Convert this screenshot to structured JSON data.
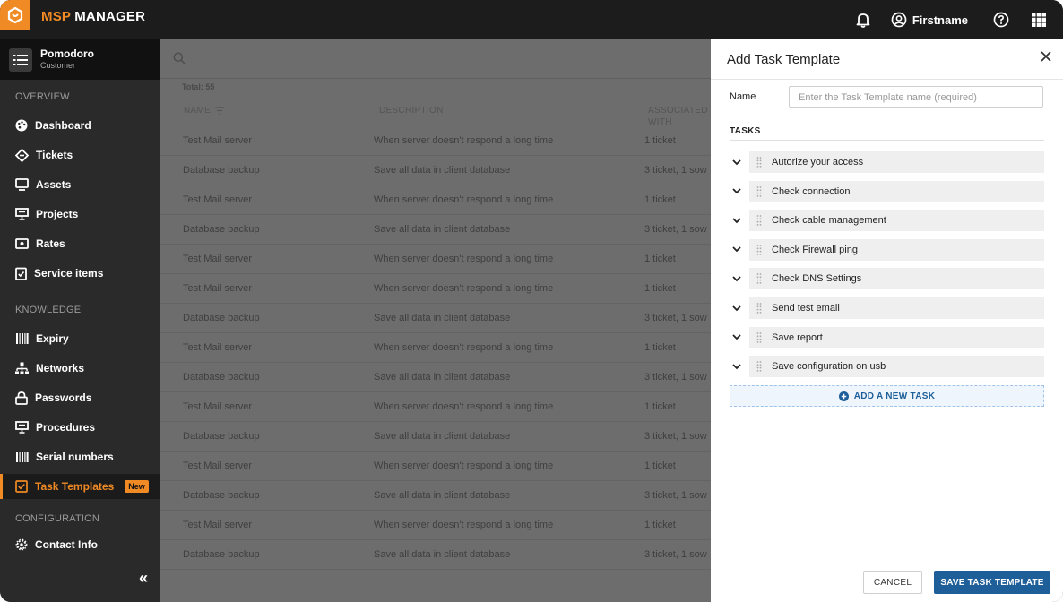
{
  "header": {
    "brand_prefix": "MSP",
    "brand_suffix": " MANAGER",
    "user_name": "Firstname",
    "icons": [
      "logo-icon",
      "bell-icon",
      "user-circle-icon",
      "help-icon",
      "apps-grid-icon"
    ],
    "accent_color": "#f08a24"
  },
  "customer": {
    "name": "Pomodoro",
    "subtitle": "Customer"
  },
  "sidebar": {
    "overview_label": "OVERVIEW",
    "knowledge_label": "KNOWLEDGE",
    "configuration_label": "CONFIGURATION",
    "overview_items": [
      {
        "label": "Dashboard",
        "icon": "palette-icon"
      },
      {
        "label": "Tickets",
        "icon": "ticket-icon"
      },
      {
        "label": "Assets",
        "icon": "monitor-icon"
      },
      {
        "label": "Projects",
        "icon": "presentation-icon"
      },
      {
        "label": "Rates",
        "icon": "money-icon"
      },
      {
        "label": "Service items",
        "icon": "clipboard-check-icon"
      }
    ],
    "knowledge_items": [
      {
        "label": "Expiry",
        "icon": "barcode-icon"
      },
      {
        "label": "Networks",
        "icon": "network-icon"
      },
      {
        "label": "Passwords",
        "icon": "lock-icon"
      },
      {
        "label": "Procedures",
        "icon": "presentation-icon"
      },
      {
        "label": "Serial numbers",
        "icon": "barcode-icon"
      },
      {
        "label": "Task Templates",
        "icon": "checkbox-icon",
        "badge": "New",
        "active": true
      }
    ],
    "configuration_items": [
      {
        "label": "Contact Info",
        "icon": "gear-icon"
      }
    ],
    "collapse_label": "«"
  },
  "list": {
    "total_label": "Total: 55",
    "columns": [
      "NAME",
      "DESCRIPTION",
      "ASSOCIATED WITH"
    ],
    "rows": [
      {
        "name": "Test Mail server",
        "description": "When server doesn't respond a long time",
        "associated": "1 ticket"
      },
      {
        "name": "Database backup",
        "description": "Save all data in client database",
        "associated": "3 ticket, 1 sow"
      },
      {
        "name": "Test Mail server",
        "description": "When server doesn't respond a long time",
        "associated": "1 ticket"
      },
      {
        "name": "Database backup",
        "description": "Save all data in client database",
        "associated": "3 ticket, 1 sow"
      },
      {
        "name": "Test Mail server",
        "description": "When server doesn't respond a long time",
        "associated": "1 ticket"
      },
      {
        "name": "Test Mail server",
        "description": "When server doesn't respond a long time",
        "associated": "1 ticket"
      },
      {
        "name": "Database backup",
        "description": "Save all data in client database",
        "associated": "3 ticket, 1 sow"
      },
      {
        "name": "Test Mail server",
        "description": "When server doesn't respond a long time",
        "associated": "1 ticket"
      },
      {
        "name": "Database backup",
        "description": "Save all data in client database",
        "associated": "3 ticket, 1 sow"
      },
      {
        "name": "Test Mail server",
        "description": "When server doesn't respond a long time",
        "associated": "1 ticket"
      },
      {
        "name": "Database backup",
        "description": "Save all data in client database",
        "associated": "3 ticket, 1 sow"
      },
      {
        "name": "Test Mail server",
        "description": "When server doesn't respond a long time",
        "associated": "1 ticket"
      },
      {
        "name": "Database backup",
        "description": "Save all data in client database",
        "associated": "3 ticket, 1 sow"
      },
      {
        "name": "Test Mail server",
        "description": "When server doesn't respond a long time",
        "associated": "1 ticket"
      },
      {
        "name": "Database backup",
        "description": "Save all data in client database",
        "associated": "3 ticket, 1 sow"
      }
    ]
  },
  "panel": {
    "title": "Add Task Template",
    "name_label": "Name",
    "name_placeholder": "Enter the Task Template name (required)",
    "name_value": "",
    "tasks_label": "TASKS",
    "tasks": [
      "Autorize your access",
      "Check connection",
      "Check cable management",
      "Check Firewall ping",
      "Check DNS Settings",
      "Send test email",
      "Save report",
      "Save configuration on usb"
    ],
    "add_task_label": "ADD A NEW TASK",
    "cancel_label": "CANCEL",
    "save_label": "SAVE TASK TEMPLATE",
    "primary_color": "#1f5f99"
  }
}
